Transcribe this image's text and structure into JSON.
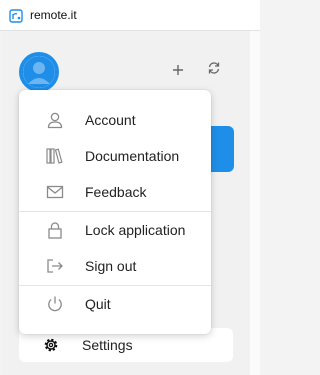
{
  "window": {
    "title": "remote.it"
  },
  "colors": {
    "accent": "#1f8ee8",
    "icon_gray": "#8a8a8a"
  },
  "header": {
    "add_icon": "plus-icon",
    "refresh_icon": "refresh-icon"
  },
  "menu": {
    "items": [
      {
        "label": "Account",
        "icon": "person-icon"
      },
      {
        "label": "Documentation",
        "icon": "books-icon"
      },
      {
        "label": "Feedback",
        "icon": "envelope-icon"
      },
      {
        "label": "Lock application",
        "icon": "lock-icon"
      },
      {
        "label": "Sign out",
        "icon": "sign-out-icon"
      },
      {
        "label": "Quit",
        "icon": "power-icon"
      }
    ]
  },
  "sidebar": {
    "settings_label": "Settings",
    "settings_icon": "gear-icon"
  }
}
